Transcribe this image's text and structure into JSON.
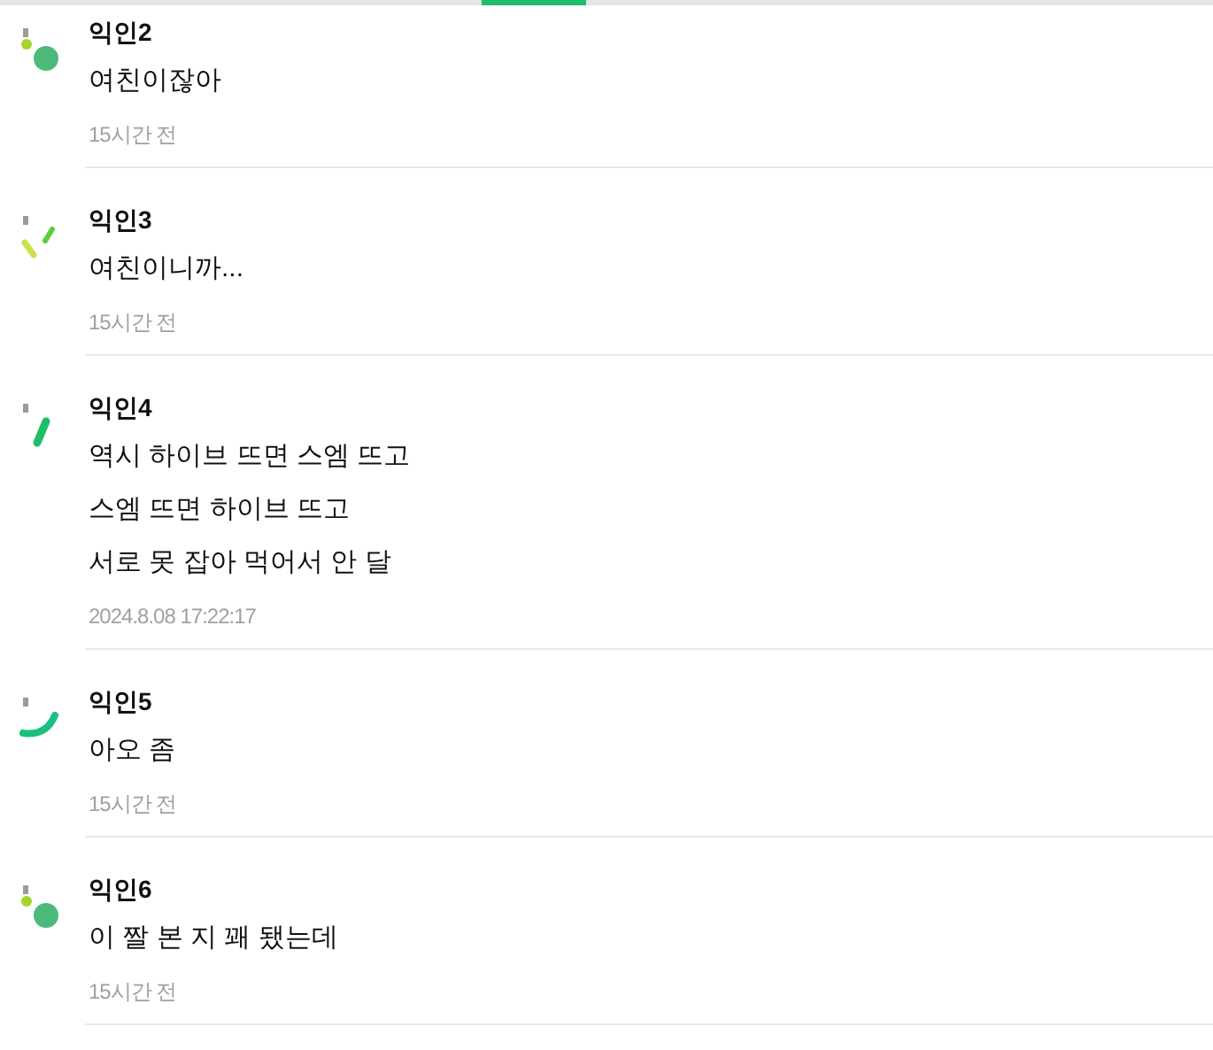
{
  "tab_indicator": {
    "selected": true
  },
  "comments": [
    {
      "author": "익인2",
      "avatar": {
        "kind": "dots"
      },
      "lines": [
        "여친이잖아"
      ],
      "time": "15시간 전"
    },
    {
      "author": "익인3",
      "avatar": {
        "kind": "dashes"
      },
      "lines": [
        "여친이니까..."
      ],
      "time": "15시간 전"
    },
    {
      "author": "익인4",
      "avatar": {
        "kind": "bar"
      },
      "lines": [
        "역시 하이브 뜨면 스엠 뜨고",
        "스엠 뜨면 하이브 뜨고",
        "서로 못 잡아 먹어서 안 달"
      ],
      "time": "2024.8.08 17:22:17"
    },
    {
      "author": "익인5",
      "avatar": {
        "kind": "arc"
      },
      "lines": [
        "아오 좀"
      ],
      "time": "15시간 전"
    },
    {
      "author": "익인6",
      "avatar": {
        "kind": "dots"
      },
      "lines": [
        "이 짤 본 지 꽤 됐는데"
      ],
      "time": "15시간 전"
    }
  ]
}
